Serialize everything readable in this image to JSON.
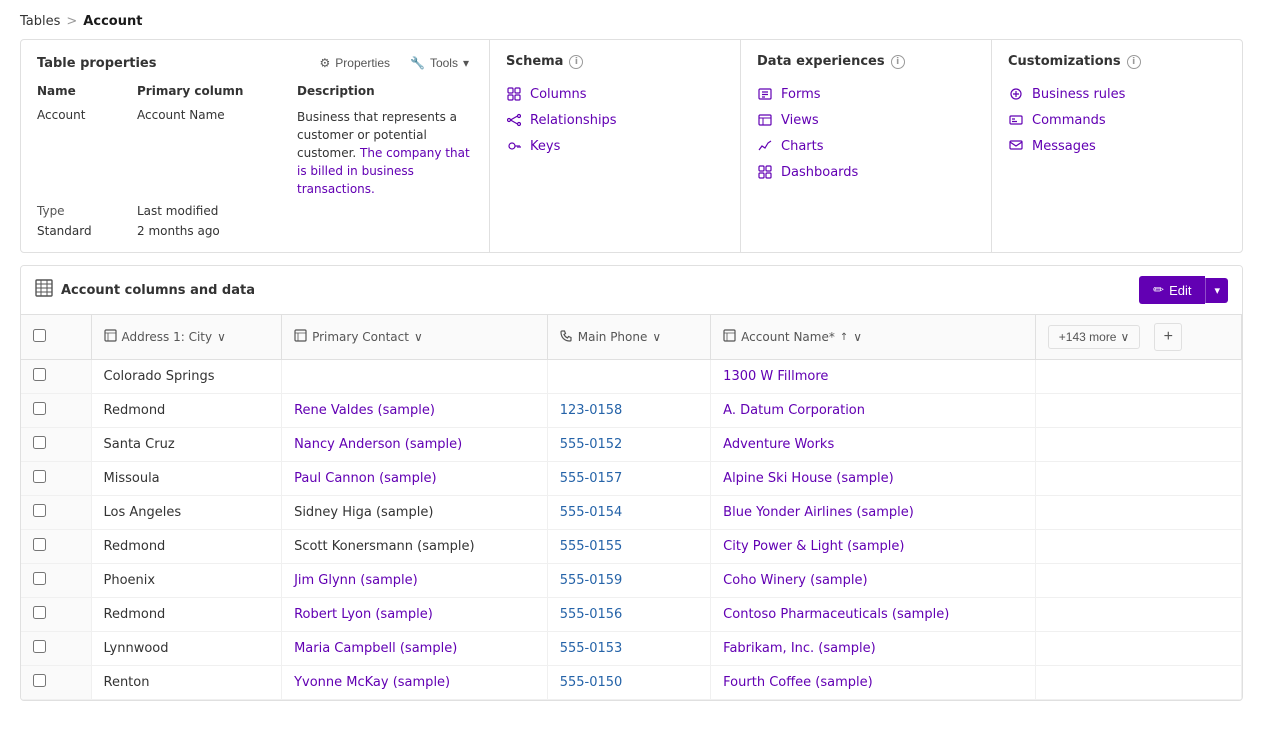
{
  "breadcrumb": {
    "tables": "Tables",
    "separator": ">",
    "current": "Account"
  },
  "tableProperties": {
    "panelTitle": "Table properties",
    "propertiesBtn": "Properties",
    "toolsBtn": "Tools",
    "columns": {
      "name": "Name",
      "primaryColumn": "Primary column",
      "description": "Description"
    },
    "nameValue": "Account",
    "typeLabel": "Type",
    "typeValue": "Standard",
    "primaryColumnValue": "Account Name",
    "lastModifiedLabel": "Last modified",
    "lastModifiedValue": "2 months ago",
    "descriptionText": "Business that represents a customer or potential customer. The company that is billed in business transactions."
  },
  "schema": {
    "title": "Schema",
    "links": [
      {
        "id": "columns",
        "label": "Columns",
        "icon": "grid"
      },
      {
        "id": "relationships",
        "label": "Relationships",
        "icon": "share"
      },
      {
        "id": "keys",
        "label": "Keys",
        "icon": "key"
      }
    ]
  },
  "dataExperiences": {
    "title": "Data experiences",
    "links": [
      {
        "id": "forms",
        "label": "Forms",
        "icon": "form"
      },
      {
        "id": "views",
        "label": "Views",
        "icon": "view"
      },
      {
        "id": "charts",
        "label": "Charts",
        "icon": "chart"
      },
      {
        "id": "dashboards",
        "label": "Dashboards",
        "icon": "dashboard"
      }
    ]
  },
  "customizations": {
    "title": "Customizations",
    "links": [
      {
        "id": "business-rules",
        "label": "Business rules",
        "icon": "rule"
      },
      {
        "id": "commands",
        "label": "Commands",
        "icon": "command"
      },
      {
        "id": "messages",
        "label": "Messages",
        "icon": "message"
      }
    ]
  },
  "dataSection": {
    "title": "Account columns and data",
    "editBtn": "Edit",
    "columns": [
      {
        "id": "checkbox",
        "label": "",
        "icon": ""
      },
      {
        "id": "address1city",
        "label": "Address 1: City",
        "icon": "col",
        "sortable": true
      },
      {
        "id": "primarycontact",
        "label": "Primary Contact",
        "icon": "col",
        "sortable": true
      },
      {
        "id": "mainphone",
        "label": "Main Phone",
        "icon": "phone",
        "sortable": true
      },
      {
        "id": "accountname",
        "label": "Account Name*",
        "icon": "col",
        "sortable": true,
        "sort": "asc"
      },
      {
        "id": "more",
        "label": "+143 more",
        "extra": true
      }
    ],
    "rows": [
      {
        "id": 1,
        "address1city": "Colorado Springs",
        "primarycontact": "",
        "mainphone": "",
        "accountname": "1300 W Fillmore",
        "contactLink": false
      },
      {
        "id": 2,
        "address1city": "Redmond",
        "primarycontact": "Rene Valdes (sample)",
        "mainphone": "123-0158",
        "accountname": "A. Datum Corporation",
        "contactLink": true
      },
      {
        "id": 3,
        "address1city": "Santa Cruz",
        "primarycontact": "Nancy Anderson (sample)",
        "mainphone": "555-0152",
        "accountname": "Adventure Works",
        "contactLink": true
      },
      {
        "id": 4,
        "address1city": "Missoula",
        "primarycontact": "Paul Cannon (sample)",
        "mainphone": "555-0157",
        "accountname": "Alpine Ski House (sample)",
        "contactLink": true
      },
      {
        "id": 5,
        "address1city": "Los Angeles",
        "primarycontact": "Sidney Higa (sample)",
        "mainphone": "555-0154",
        "accountname": "Blue Yonder Airlines (sample)",
        "contactLink": false
      },
      {
        "id": 6,
        "address1city": "Redmond",
        "primarycontact": "Scott Konersmann (sample)",
        "mainphone": "555-0155",
        "accountname": "City Power & Light (sample)",
        "contactLink": false
      },
      {
        "id": 7,
        "address1city": "Phoenix",
        "primarycontact": "Jim Glynn (sample)",
        "mainphone": "555-0159",
        "accountname": "Coho Winery (sample)",
        "contactLink": true
      },
      {
        "id": 8,
        "address1city": "Redmond",
        "primarycontact": "Robert Lyon (sample)",
        "mainphone": "555-0156",
        "accountname": "Contoso Pharmaceuticals (sample)",
        "contactLink": true
      },
      {
        "id": 9,
        "address1city": "Lynnwood",
        "primarycontact": "Maria Campbell (sample)",
        "mainphone": "555-0153",
        "accountname": "Fabrikam, Inc. (sample)",
        "contactLink": true
      },
      {
        "id": 10,
        "address1city": "Renton",
        "primarycontact": "Yvonne McKay (sample)",
        "mainphone": "555-0150",
        "accountname": "Fourth Coffee (sample)",
        "contactLink": true
      }
    ]
  },
  "colors": {
    "accent": "#6200b3",
    "linkColor": "#6200b3",
    "phoneColor": "#2563a8"
  }
}
